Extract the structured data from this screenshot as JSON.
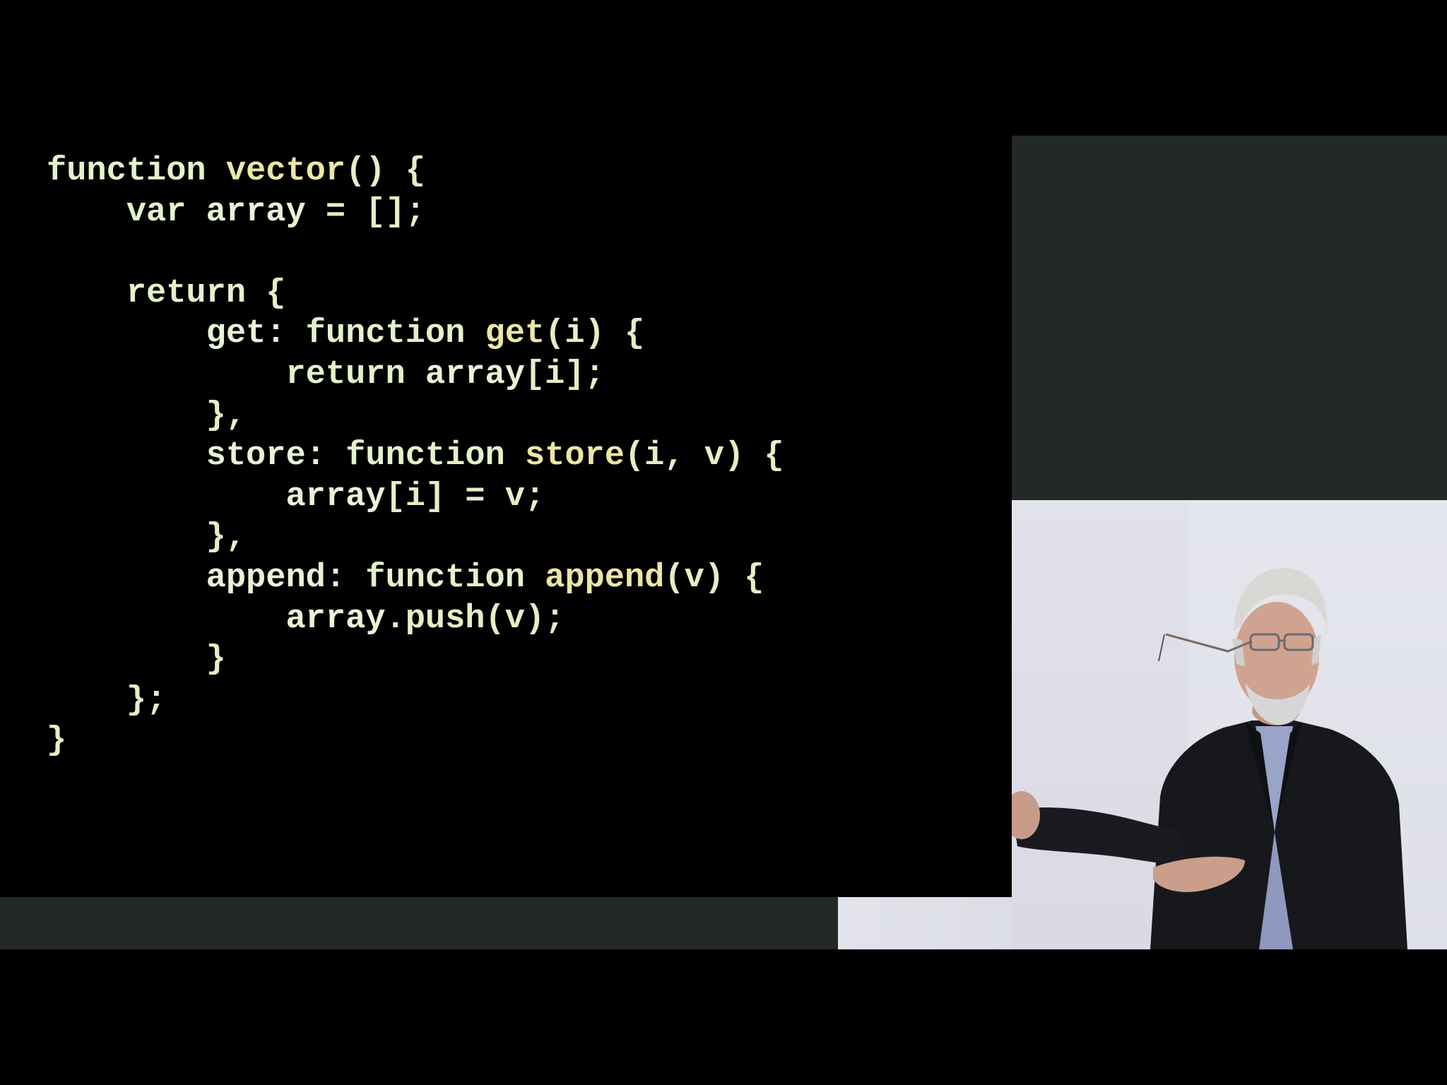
{
  "slide": {
    "code_lines": [
      [
        {
          "t": "function ",
          "c": "kw"
        },
        {
          "t": "vector",
          "c": "fn"
        },
        {
          "t": "() {",
          "c": "punct"
        }
      ],
      [
        {
          "t": "    var ",
          "c": "kw"
        },
        {
          "t": "array",
          "c": "id"
        },
        {
          "t": " = [];",
          "c": "punct"
        }
      ],
      [],
      [
        {
          "t": "    return ",
          "c": "kw"
        },
        {
          "t": "{",
          "c": "punct"
        }
      ],
      [
        {
          "t": "        get: ",
          "c": "id"
        },
        {
          "t": "function ",
          "c": "kw"
        },
        {
          "t": "get",
          "c": "fn"
        },
        {
          "t": "(i) {",
          "c": "punct"
        }
      ],
      [
        {
          "t": "            return ",
          "c": "kw"
        },
        {
          "t": "array",
          "c": "id"
        },
        {
          "t": "[i];",
          "c": "punct"
        }
      ],
      [
        {
          "t": "        },",
          "c": "punct"
        }
      ],
      [
        {
          "t": "        store: ",
          "c": "id"
        },
        {
          "t": "function ",
          "c": "kw"
        },
        {
          "t": "store",
          "c": "fn"
        },
        {
          "t": "(i, v) {",
          "c": "punct"
        }
      ],
      [
        {
          "t": "            array",
          "c": "id"
        },
        {
          "t": "[i] = v;",
          "c": "punct"
        }
      ],
      [
        {
          "t": "        },",
          "c": "punct"
        }
      ],
      [
        {
          "t": "        append: ",
          "c": "id"
        },
        {
          "t": "function ",
          "c": "kw"
        },
        {
          "t": "append",
          "c": "fn"
        },
        {
          "t": "(v) {",
          "c": "punct"
        }
      ],
      [
        {
          "t": "            array",
          "c": "id"
        },
        {
          "t": ".push(v);",
          "c": "punct"
        }
      ],
      [
        {
          "t": "        }",
          "c": "punct"
        }
      ],
      [
        {
          "t": "    };",
          "c": "punct"
        }
      ],
      [
        {
          "t": "}",
          "c": "punct"
        }
      ]
    ]
  },
  "colors": {
    "background": "#000000",
    "panel": "#222927",
    "code_keyword": "#e4f2cc",
    "code_identifier": "#e9f3d6",
    "code_function": "#ece7a6",
    "code_punct": "#e9edc5"
  }
}
